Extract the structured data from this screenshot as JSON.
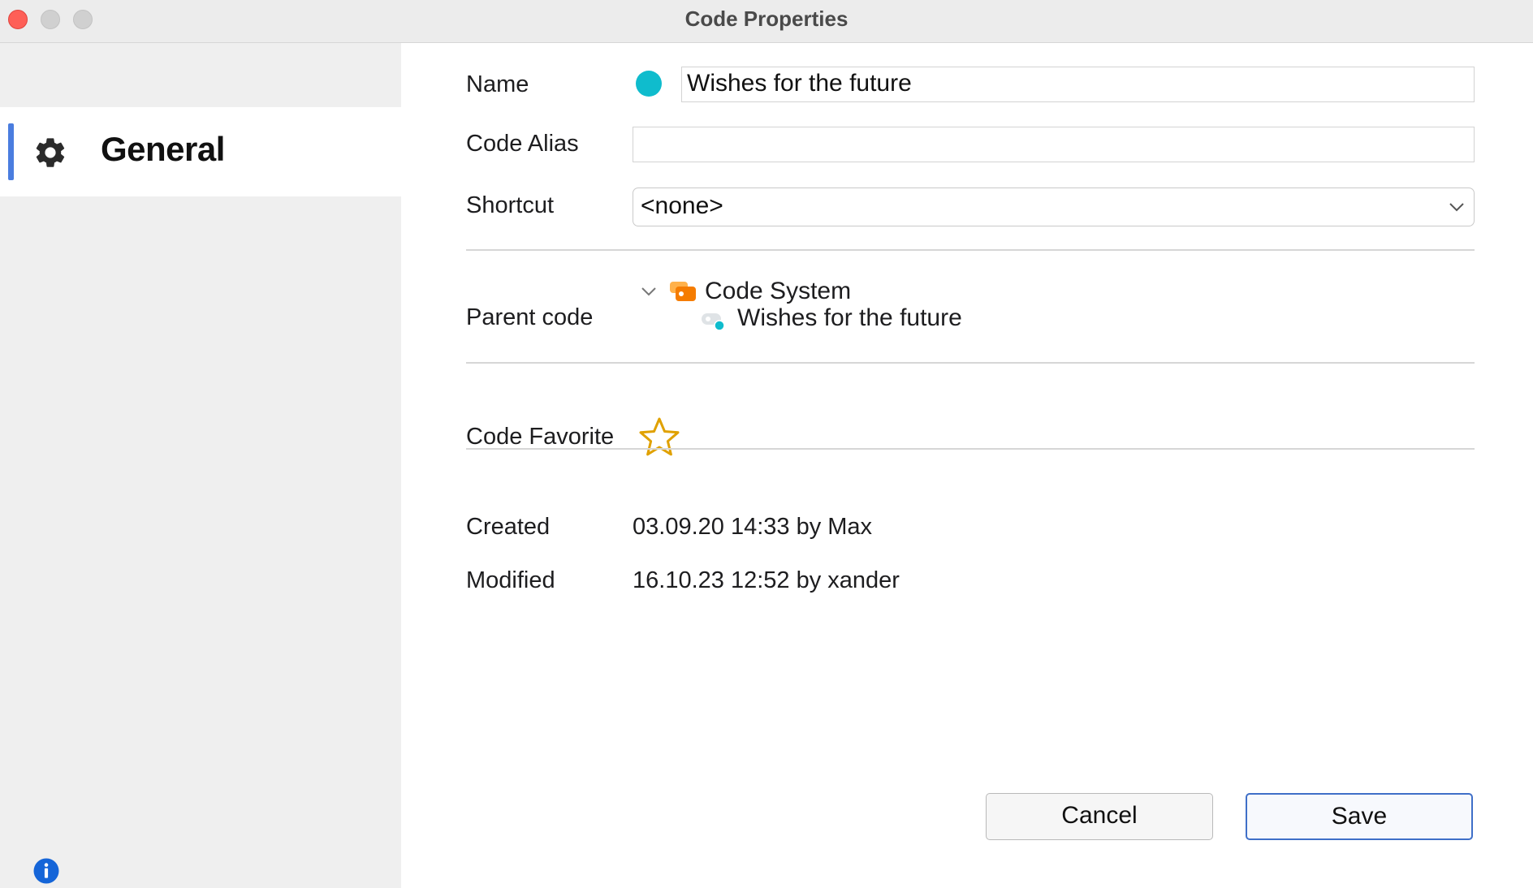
{
  "window": {
    "title": "Code Properties"
  },
  "sidebar": {
    "items": [
      {
        "label": "General",
        "icon": "gear-icon",
        "selected": true
      }
    ],
    "info_icon": "info-icon"
  },
  "form": {
    "name": {
      "label": "Name",
      "value": "Wishes for the future",
      "color": "#0fbccd"
    },
    "code_alias": {
      "label": "Code Alias",
      "value": ""
    },
    "shortcut": {
      "label": "Shortcut",
      "value": "<none>"
    },
    "parent_code": {
      "label": "Parent code",
      "tree": [
        {
          "label": "Code System",
          "icon": "code-system-icon",
          "expanded": true
        },
        {
          "label": "Wishes for the future",
          "icon": "code-icon"
        }
      ]
    },
    "favorite": {
      "label": "Code Favorite",
      "starred": false
    },
    "created": {
      "label": "Created",
      "value": "03.09.20 14:33 by Max"
    },
    "modified": {
      "label": "Modified",
      "value": "16.10.23 12:52 by xander"
    }
  },
  "buttons": {
    "cancel": "Cancel",
    "save": "Save"
  },
  "colors": {
    "accent": "#4a7ddf",
    "star": "#e0a100",
    "code_system": "#f57c00"
  }
}
